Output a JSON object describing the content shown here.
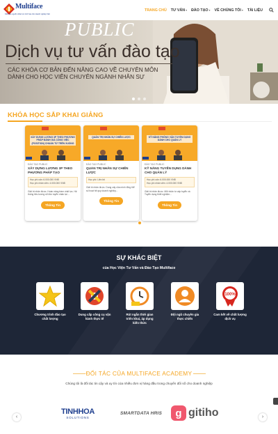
{
  "header": {
    "logo_text": "Multiface",
    "logo_tagline": "Kiến tạo nguồn nhân lực tinh hoa cho doanh nghiệp Việt",
    "nav": [
      {
        "label": "TRANG CHỦ",
        "active": true,
        "dropdown": false
      },
      {
        "label": "TƯ VẤN",
        "active": false,
        "dropdown": true
      },
      {
        "label": "ĐÀO TẠO",
        "active": false,
        "dropdown": true
      },
      {
        "label": "VỀ CHÚNG TÔI",
        "active": false,
        "dropdown": true
      },
      {
        "label": "TÀI LIỆU",
        "active": false,
        "dropdown": false
      }
    ]
  },
  "hero": {
    "overlay_word": "PUBLIC",
    "title": "Dịch vụ tư vấn đào tạo",
    "subtitle_line1": "CÁC KHÓA CƠ BẢN ĐẾN NÂNG CAO VỀ CHUYÊN MÔN",
    "subtitle_line2": "DÀNH CHO HỌC VIÊN CHUYÊN NGÀNH NHÂN SỰ",
    "slide_count": 3,
    "active_slide": 0
  },
  "courses": {
    "title": "KHÓA HỌC SẮP KHAI GIẢNG",
    "items": [
      {
        "image_caption": "XÂY DỰNG LƯƠNG 3P THEO PHƯƠNG PHÁP ĐÁNH GIÁ CÔNG VIỆC (POSITION) CHUẨN TỪ TRÊN XUỐNG",
        "meta": "ĐÀO TẠO PUBLIC",
        "name": "XÂY DỰNG LƯƠNG 3P THEO PHƯƠNG PHÁP TẠO \"POSITION...",
        "price1": "Học phí cấn: 6.000.000 VNĐ",
        "price2": "Học phí nhân viên: 4.000.000 VNĐ",
        "desc": "Giải tri nhân được. Hoàn nâng trầm chất lực. Hệ thống tiêu lương sổ đòn tuyển nhân tại ...",
        "button": "Thông Tin"
      },
      {
        "image_caption": "QUẢN TRỊ NHÂN SỰ CHIẾN LƯỢC",
        "meta": "ĐÀO TẠO PUBLIC",
        "name": "QUẢN TRỊ NHÂN SỰ CHIẾN LƯỢC",
        "price1": "Học phí: Liên hệ",
        "price2": "",
        "desc": "Giải tri nhân được. Dung cấy của mình tổng thể số hoạt hệ quy doanh nghiệp...",
        "button": "Thông Tin"
      },
      {
        "image_caption": "KỸ NĂNG PHỎNG VẤN TUYỂN DỤNG DÀNH CHO QUẢN LÝ",
        "meta": "ĐÀO TẠO PUBLIC",
        "name": "KỸ NĂNG TUYỂN DỤNG DÀNH CHO QUẢN LÝ",
        "price1": "Học phí cấn: 6.000.000 VNĐ",
        "price2": "Học phí nhân viên: 4.000.000 VNĐ",
        "desc": "Giải tri nhân được. Mỗi nhân tư cấp tuyển và Tuyển dụng thiết nghiệm...",
        "button": "Thông Tin"
      }
    ]
  },
  "difference": {
    "title": "SỰ KHÁC BIỆT",
    "subtitle": "của Học Viện Tư Vấn và Đào Tạo Multiface",
    "features": [
      {
        "icon": "star-icon",
        "label": "Chương trình đào tạo chất lượng"
      },
      {
        "icon": "tools-icon",
        "label": "Dung cấp công cụ vận hành thực tế"
      },
      {
        "icon": "clock-icon",
        "label": "Rút ngắn thời gian triển khai, áp dụng kiến thức"
      },
      {
        "icon": "expert-icon",
        "label": "Đội ngũ chuyên gia thực chiến"
      },
      {
        "icon": "guarantee-icon",
        "label": "Cam kết về chất lượng dịch vụ"
      }
    ]
  },
  "partners": {
    "title": "ĐỐI TÁC CỦA MULTIFACE ACADEMY",
    "subtitle": "Chúng tôi là đối tác tin cậy và uy tín của nhiều đơn vị hàng đầu trong chuyển đổi số cho doanh nghiệp",
    "logos": [
      {
        "name": "TINHHOA",
        "sub": "SOLUTIONS"
      },
      {
        "name": "SMARTDATA HRIS",
        "sub": ""
      },
      {
        "name": "gitiho",
        "sub": ""
      }
    ],
    "prev": "‹",
    "next": "›"
  },
  "colors": {
    "accent": "#f5a623",
    "dark_section": "#1e2637",
    "brand_blue": "#1f3f8f"
  }
}
